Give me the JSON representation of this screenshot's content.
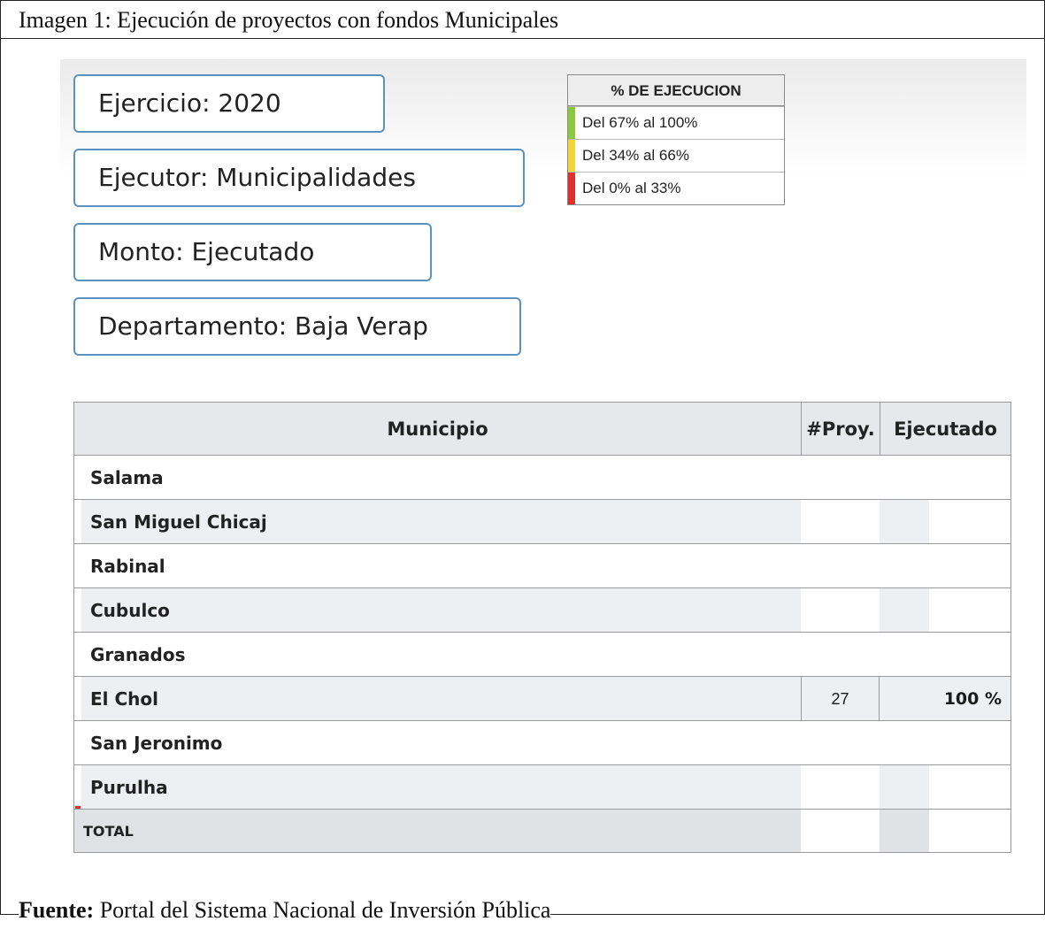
{
  "caption": "Imagen 1: Ejecución de proyectos con fondos Municipales",
  "filters": {
    "ejercicio": "Ejercicio: 2020",
    "ejecutor": "Ejecutor: Municipalidades",
    "monto": "Monto: Ejecutado",
    "departamento": "Departamento: Baja Verap"
  },
  "legend": {
    "title": "% DE EJECUCION",
    "items": [
      {
        "label": "Del 67% al 100%",
        "color": "#8dc63f"
      },
      {
        "label": "Del 34% al 66%",
        "color": "#f2d43b"
      },
      {
        "label": "Del 0% al 33%",
        "color": "#e0302c"
      }
    ]
  },
  "table": {
    "headers": {
      "municipio": "Municipio",
      "proyectos": "#Proy.",
      "ejecutado": "Ejecutado"
    },
    "rows": [
      {
        "municipio": "Salama",
        "proyectos": "",
        "ejecutado": ""
      },
      {
        "municipio": "San Miguel Chicaj",
        "proyectos": "",
        "ejecutado": ""
      },
      {
        "municipio": "Rabinal",
        "proyectos": "",
        "ejecutado": ""
      },
      {
        "municipio": "Cubulco",
        "proyectos": "",
        "ejecutado": ""
      },
      {
        "municipio": "Granados",
        "proyectos": "",
        "ejecutado": ""
      },
      {
        "municipio": "El Chol",
        "proyectos": "27",
        "ejecutado": "100 %"
      },
      {
        "municipio": "San Jeronimo",
        "proyectos": "",
        "ejecutado": ""
      },
      {
        "municipio": "Purulha",
        "proyectos": "",
        "ejecutado": ""
      }
    ],
    "total_label": "TOTAL"
  },
  "source": {
    "label": "Fuente:",
    "text": " Portal del Sistema Nacional de Inversión Pública"
  }
}
